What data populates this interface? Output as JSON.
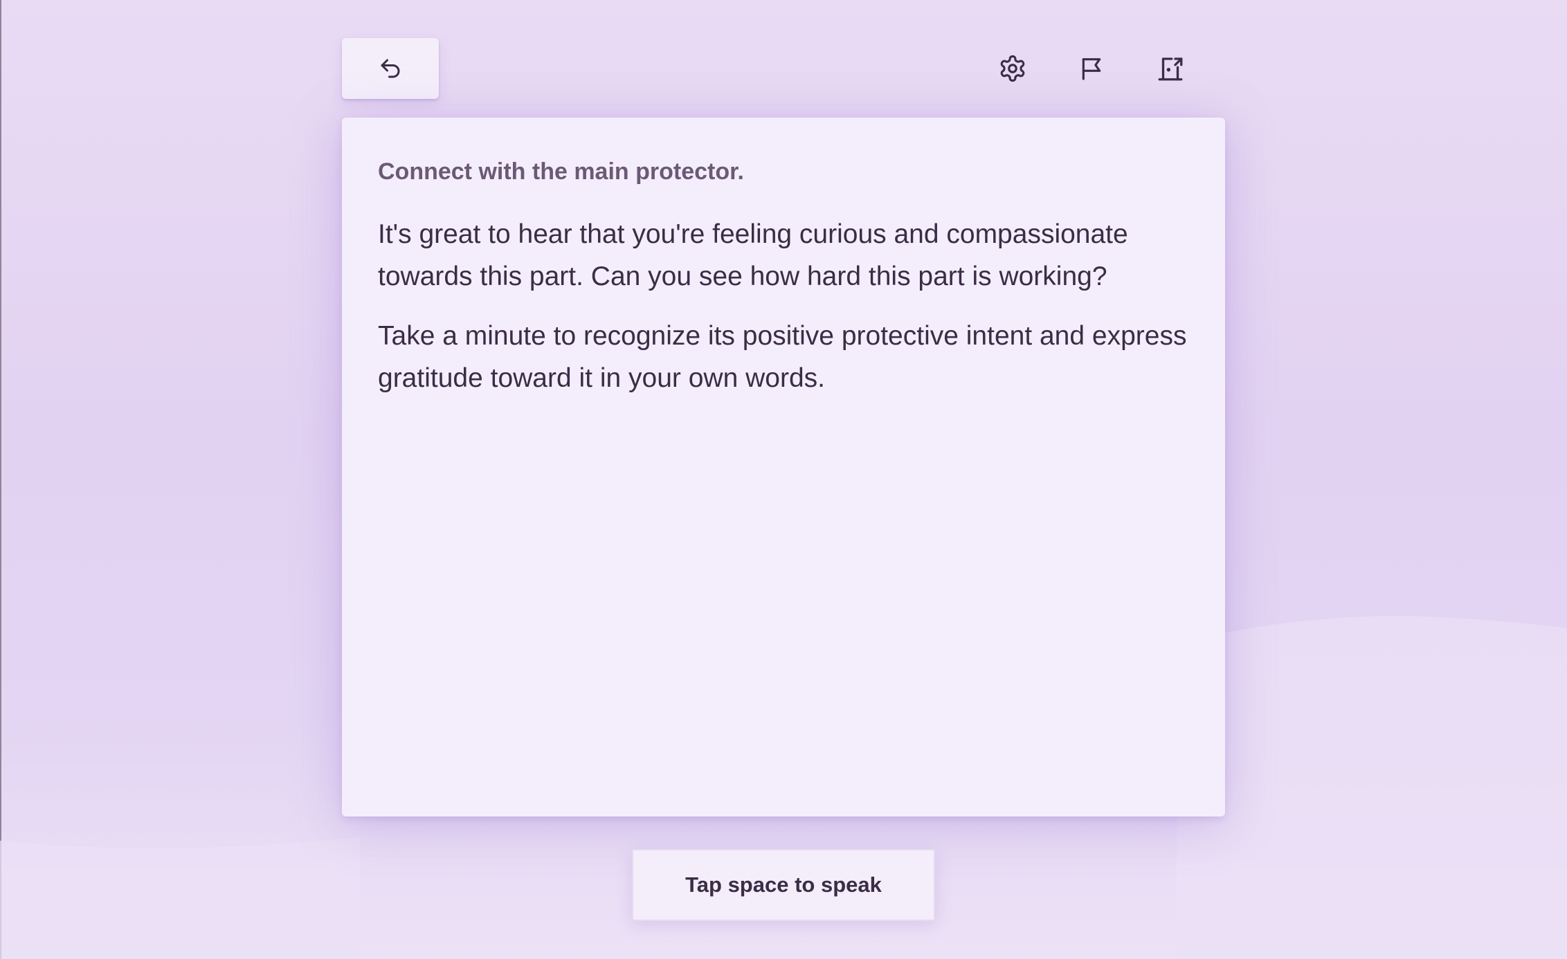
{
  "toolbar": {
    "back_icon": "undo-arrow-icon",
    "settings_icon": "gear-icon",
    "flag_icon": "flag-icon",
    "exit_icon": "exit-door-icon"
  },
  "card": {
    "title": "Connect with the main protector.",
    "paragraphs": [
      "It's great to hear that you're feeling curious and compassionate towards this part. Can you see how hard this part is working?",
      "Take a minute to recognize its positive protective intent and express gratitude toward it in your own words."
    ]
  },
  "speak_button": {
    "label": "Tap space to speak"
  },
  "colors": {
    "background": "#e6d7f3",
    "card": "#f4eefc",
    "text": "#3a2d45",
    "muted_text": "#6a5a75"
  }
}
